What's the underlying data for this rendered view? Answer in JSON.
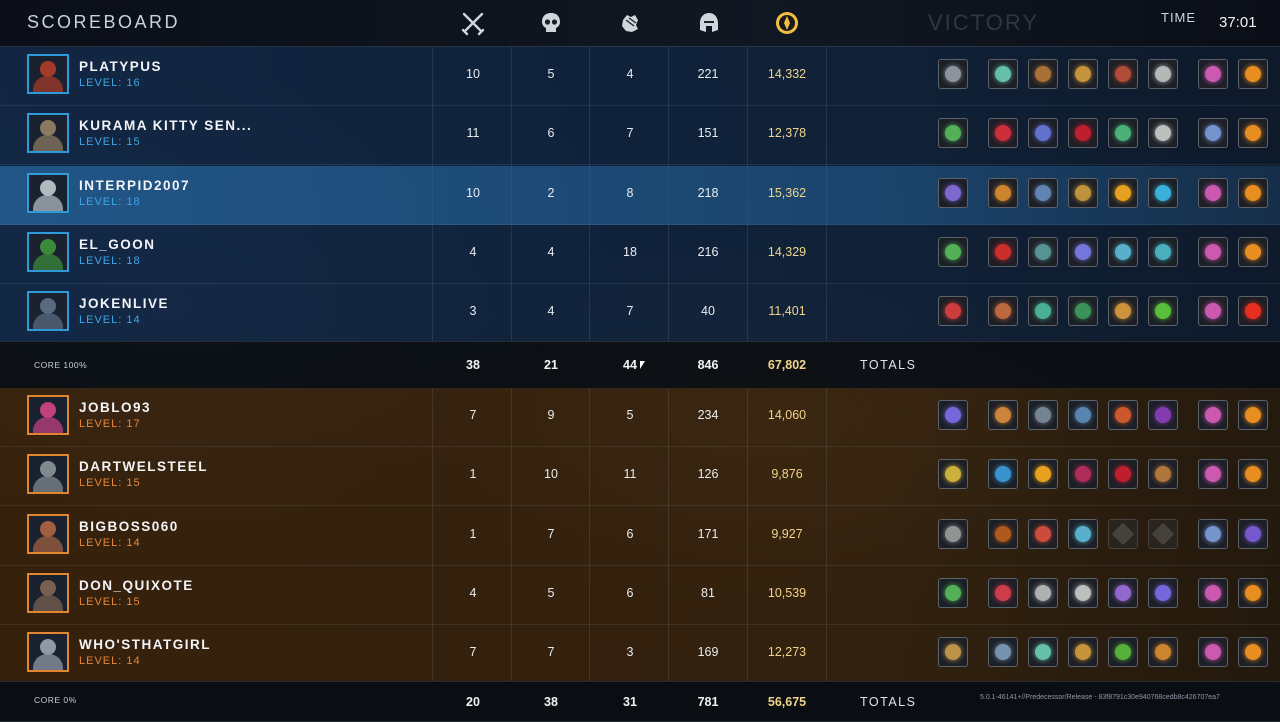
{
  "header": {
    "title": "SCOREBOARD",
    "victory": "VICTORY",
    "time_label": "TIME",
    "time_value": "37:01",
    "columns": [
      {
        "icon": "crossed-swords-icon"
      },
      {
        "icon": "skull-icon"
      },
      {
        "icon": "assist-fist-icon"
      },
      {
        "icon": "minion-helmet-icon"
      },
      {
        "icon": "gold-coin-icon"
      }
    ]
  },
  "colors": {
    "blue_accent": "#2e9ad8",
    "orange_accent": "#e2862e",
    "gold": "#f1d48a"
  },
  "teams": [
    {
      "side": "blue",
      "players": [
        {
          "name": "PLATYPUS",
          "level": "LEVEL: 16",
          "kills": "10",
          "deaths": "5",
          "assists": "4",
          "cs": "221",
          "gold": "14,332",
          "highlight": false,
          "portrait_color": "#a33a2a",
          "items": [
            "#9aa0aa",
            "#6fd1b8",
            "#b87a3a",
            "#d9a040",
            "#c0503a",
            "#c8c8c8",
            "#e060c0",
            "#ff9a20"
          ]
        },
        {
          "name": "KURAMA KITTY SEN...",
          "level": "LEVEL: 15",
          "kills": "11",
          "deaths": "6",
          "assists": "7",
          "cs": "151",
          "gold": "12,378",
          "highlight": false,
          "portrait_color": "#8a7a60",
          "items": [
            "#5ac060",
            "#e03040",
            "#6a7ae0",
            "#d02030",
            "#50c080",
            "#d0d0d0",
            "#80a0e0",
            "#ff9a20"
          ]
        },
        {
          "name": "INTERPID2007",
          "level": "LEVEL: 18",
          "kills": "10",
          "deaths": "2",
          "assists": "8",
          "cs": "218",
          "gold": "15,362",
          "highlight": true,
          "portrait_color": "#b0b8c0",
          "items": [
            "#8a70e0",
            "#e09030",
            "#6a90c0",
            "#d0a040",
            "#ffb020",
            "#40c0f0",
            "#e060c0",
            "#ff9a20"
          ]
        },
        {
          "name": "EL_GOON",
          "level": "LEVEL: 18",
          "kills": "4",
          "deaths": "4",
          "assists": "18",
          "cs": "216",
          "gold": "14,329",
          "highlight": false,
          "portrait_color": "#3a8a3a",
          "items": [
            "#5ac060",
            "#e03030",
            "#60a0a0",
            "#8080f0",
            "#60c0e0",
            "#50c0d0",
            "#e060c0",
            "#ff9a20"
          ]
        },
        {
          "name": "JOKENLIVE",
          "level": "LEVEL: 14",
          "kills": "3",
          "deaths": "4",
          "assists": "7",
          "cs": "40",
          "gold": "11,401",
          "highlight": false,
          "portrait_color": "#5a6a80",
          "items": [
            "#e04040",
            "#d07040",
            "#50c0a0",
            "#40a060",
            "#e0a040",
            "#60d040",
            "#e060c0",
            "#ff3020"
          ]
        }
      ],
      "totals": {
        "core": "CORE 100%",
        "kills": "38",
        "deaths": "21",
        "assists": "44",
        "cs": "846",
        "gold": "67,802",
        "label": "TOTALS"
      }
    },
    {
      "side": "orange",
      "players": [
        {
          "name": "JOBLO93",
          "level": "LEVEL: 17",
          "kills": "7",
          "deaths": "9",
          "assists": "5",
          "cs": "234",
          "gold": "14,060",
          "highlight": false,
          "portrait_color": "#c04080",
          "items": [
            "#8070f0",
            "#e09040",
            "#8090a0",
            "#6090c0",
            "#e06030",
            "#9040c0",
            "#e060c0",
            "#ff9a20"
          ]
        },
        {
          "name": "DARTWELSTEEL",
          "level": "LEVEL: 15",
          "kills": "1",
          "deaths": "10",
          "assists": "11",
          "cs": "126",
          "gold": "9,876",
          "highlight": false,
          "portrait_color": "#808890",
          "items": [
            "#e0c040",
            "#40a0e0",
            "#ffb020",
            "#c03060",
            "#d02030",
            "#c08040",
            "#e060c0",
            "#ff9a20"
          ]
        },
        {
          "name": "BIGBOSS060",
          "level": "LEVEL: 14",
          "kills": "1",
          "deaths": "7",
          "assists": "6",
          "cs": "171",
          "gold": "9,927",
          "highlight": false,
          "portrait_color": "#a06040",
          "items": [
            "#a0a0a0",
            "#c06020",
            "#e05040",
            "#60c0e0",
            "empty",
            "empty",
            "#80a0e0",
            "#8060e0"
          ]
        },
        {
          "name": "DON_QUIXOTE",
          "level": "LEVEL: 15",
          "kills": "4",
          "deaths": "5",
          "assists": "6",
          "cs": "81",
          "gold": "10,539",
          "highlight": false,
          "portrait_color": "#7a6050",
          "items": [
            "#5ac060",
            "#e04050",
            "#c0c0c0",
            "#d0d0d0",
            "#a070e0",
            "#8070f0",
            "#e060c0",
            "#ff9a20"
          ]
        },
        {
          "name": "WHO'STHATGIRL",
          "level": "LEVEL: 14",
          "kills": "7",
          "deaths": "7",
          "assists": "3",
          "cs": "169",
          "gold": "12,273",
          "highlight": false,
          "portrait_color": "#9098a8",
          "items": [
            "#d0a050",
            "#80a0c0",
            "#6fd1b8",
            "#d9a040",
            "#60c040",
            "#e09030",
            "#e060c0",
            "#ff9a20"
          ]
        }
      ],
      "totals": {
        "core": "CORE 0%",
        "kills": "20",
        "deaths": "38",
        "assists": "31",
        "cs": "781",
        "gold": "56,675",
        "label": "TOTALS"
      }
    }
  ],
  "version": "5.0.1-46141+//Predecessor/Release - 83f8791c30e940768cedb8c426707ea7"
}
